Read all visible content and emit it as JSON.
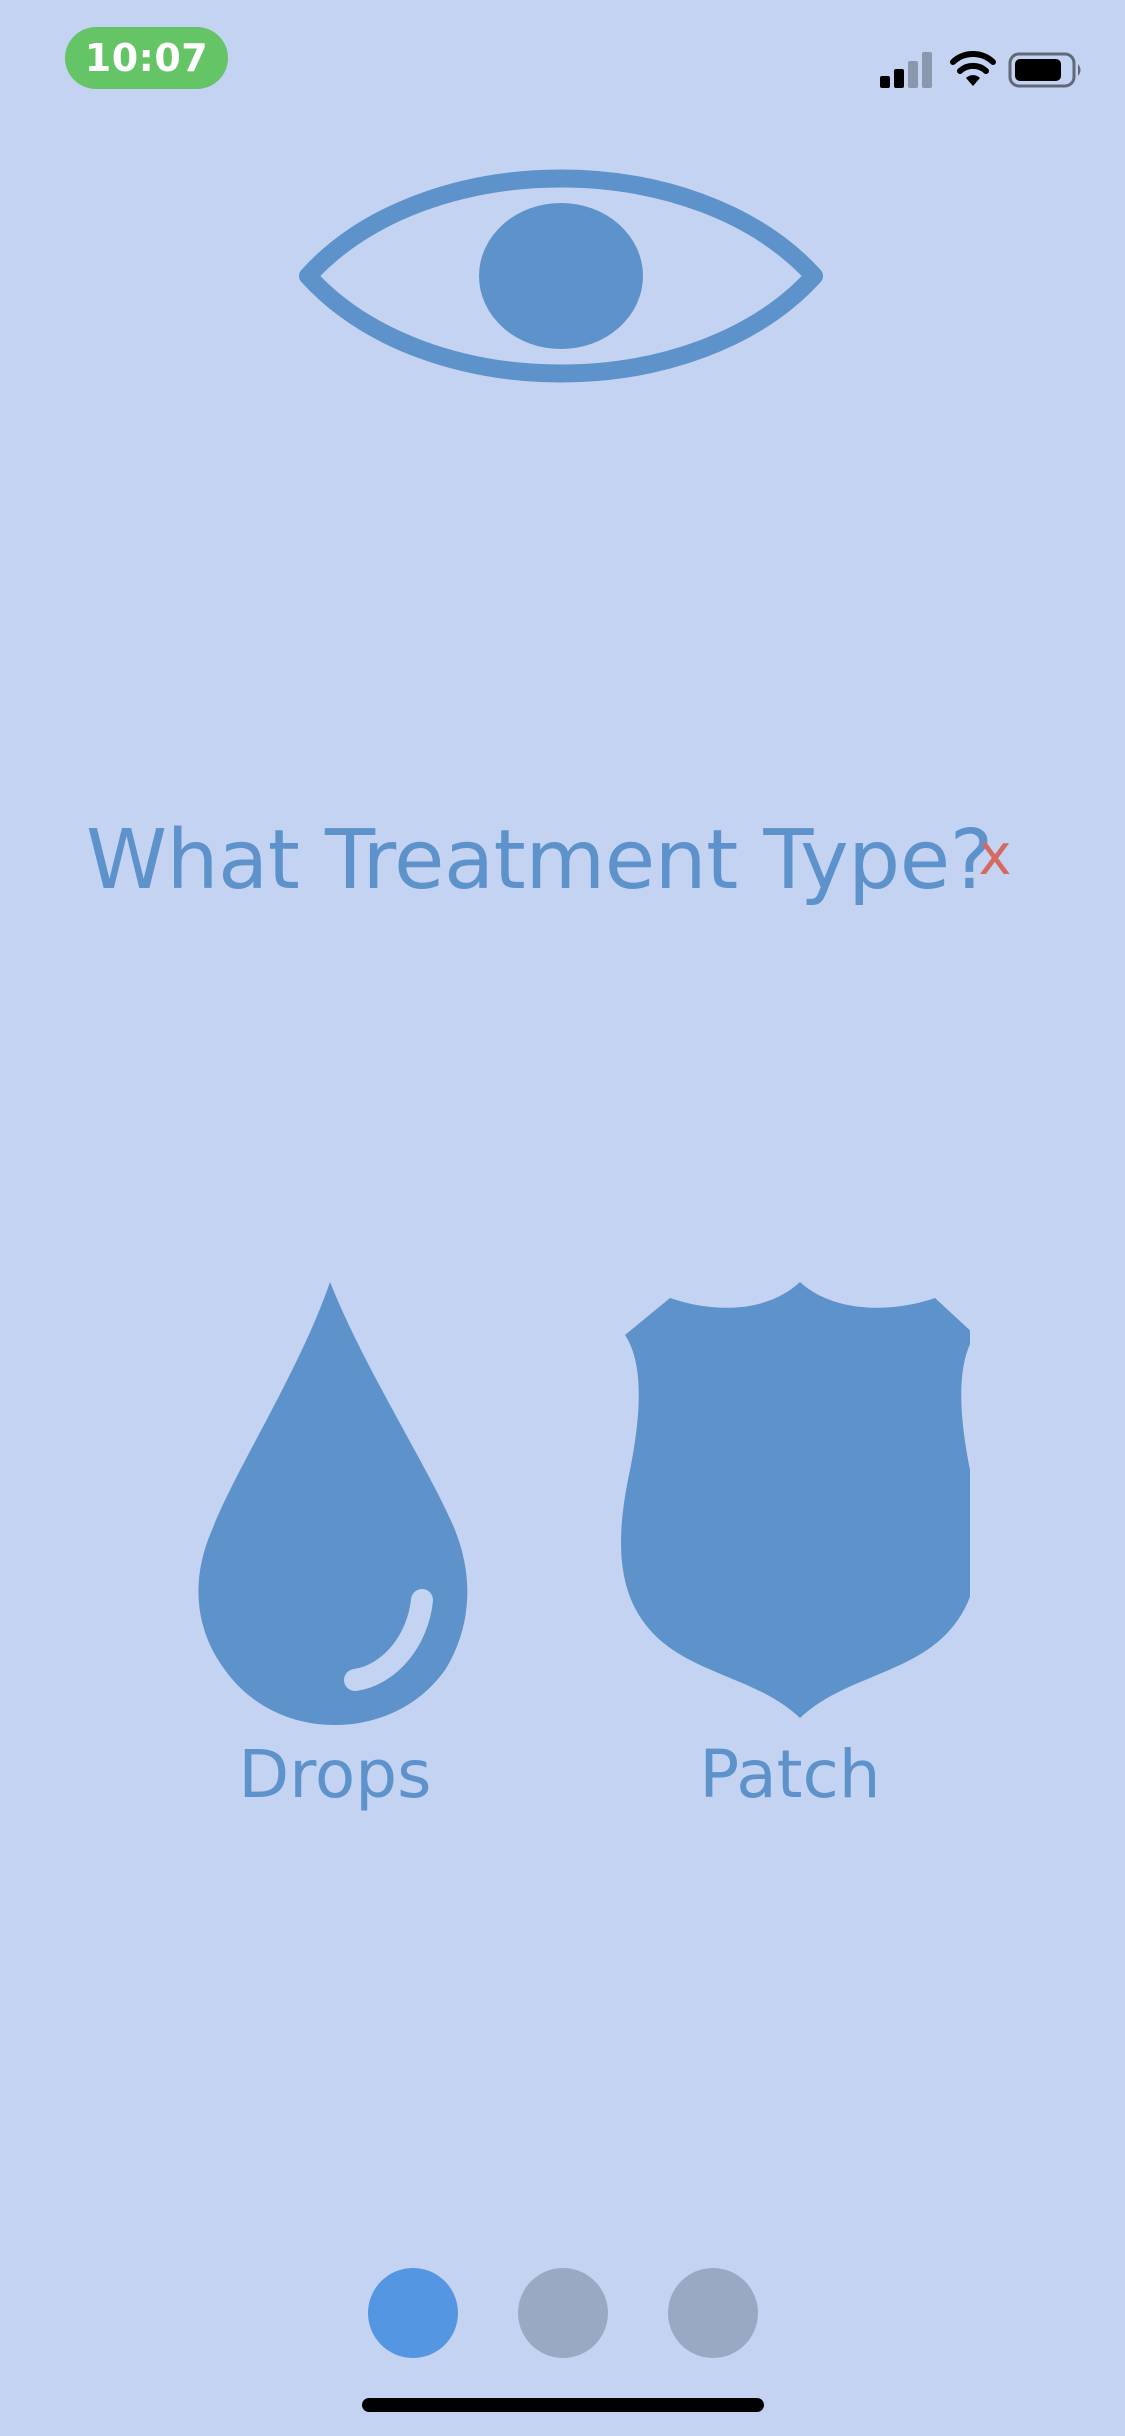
{
  "status_bar": {
    "time": "10:07",
    "signal_icon": "cellular-signal-icon",
    "wifi_icon": "wifi-icon",
    "battery_icon": "battery-icon"
  },
  "header": {
    "icon": "eye-icon"
  },
  "question": {
    "text": "What Treatment Type?",
    "close_label": "x"
  },
  "options": [
    {
      "label": "Drops",
      "icon": "water-drop-icon"
    },
    {
      "label": "Patch",
      "icon": "shield-icon"
    }
  ],
  "pagination": {
    "total": 3,
    "current": 1
  },
  "colors": {
    "background": "#c3d3f1",
    "accent": "#5e92cb",
    "close": "#d46a62",
    "time_pill": "#65c466",
    "dot_active": "#5596e2",
    "dot_inactive": "#99a9c4"
  }
}
